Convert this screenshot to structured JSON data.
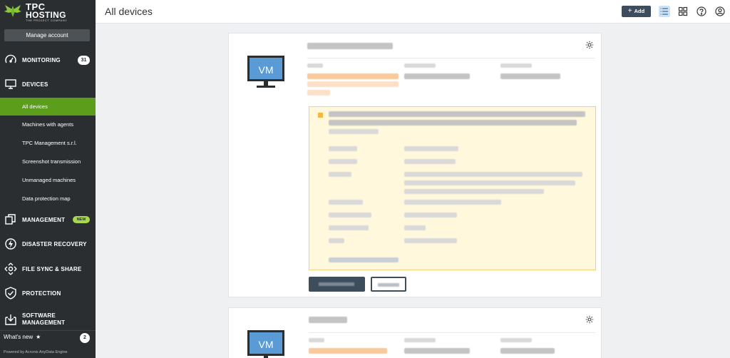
{
  "brand": {
    "line1": "TPC",
    "line2": "HOSTING",
    "tagline": "THE PROJECT COMPANY",
    "accent": "#5c9d1c"
  },
  "sidebar": {
    "manage_account": "Manage account",
    "sections": [
      {
        "label": "MONITORING",
        "icon": "speedometer-icon",
        "badge": "31"
      },
      {
        "label": "DEVICES",
        "icon": "monitor-icon"
      },
      {
        "label": "MANAGEMENT",
        "icon": "copy-icon",
        "badge_new": "NEW"
      },
      {
        "label": "DISASTER RECOVERY",
        "icon": "bolt-icon"
      },
      {
        "label": "FILE SYNC & SHARE",
        "icon": "arrows-move-icon"
      },
      {
        "label": "PROTECTION",
        "icon": "shield-check-icon"
      },
      {
        "label": "SOFTWARE MANAGEMENT",
        "icon": "download-box-icon"
      }
    ],
    "devices_items": [
      "All devices",
      "Machines with agents",
      "TPC Management s.r.l.",
      "Screenshot transmission",
      "Unmanaged machines",
      "Data protection map"
    ],
    "active_item": "All devices",
    "whats_new": "What's new",
    "whats_new_badge": "2",
    "powered_by": "Powered by Acronis AnyData Engine"
  },
  "topbar": {
    "title": "All devices",
    "add_label": "Add",
    "icons": [
      "list-view-icon",
      "grid-view-icon",
      "help-icon",
      "account-icon"
    ]
  },
  "cards": [
    {
      "device_label": "VM"
    },
    {
      "device_label": "VM"
    }
  ]
}
